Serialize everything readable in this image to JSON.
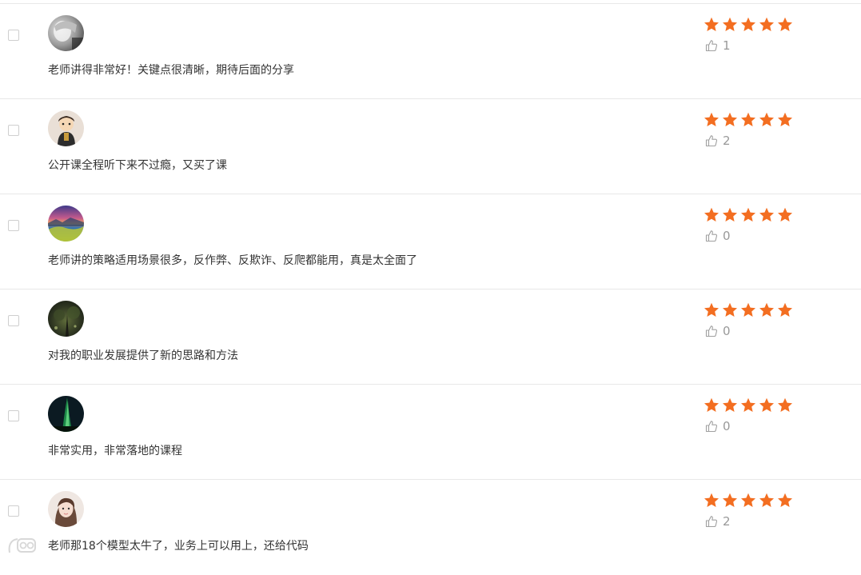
{
  "colors": {
    "star": "#f36e21",
    "divider": "#e8e8e8",
    "like_text": "#999999",
    "text": "#333333"
  },
  "rating_max": 5,
  "reviews": [
    {
      "avatar": "avatar-gray-portrait",
      "comment": "老师讲得非常好！关键点很清晰，期待后面的分享",
      "rating": 5,
      "likes": "1"
    },
    {
      "avatar": "avatar-cartoon-figure",
      "comment": "公开课全程听下来不过瘾，又买了课",
      "rating": 5,
      "likes": "2"
    },
    {
      "avatar": "avatar-sunset-landscape",
      "comment": "老师讲的策略适用场景很多，反作弊、反欺诈、反爬都能用，真是太全面了",
      "rating": 5,
      "likes": "0"
    },
    {
      "avatar": "avatar-dark-forest",
      "comment": "对我的职业发展提供了新的思路和方法",
      "rating": 5,
      "likes": "0"
    },
    {
      "avatar": "avatar-aurora",
      "comment": "非常实用，非常落地的课程",
      "rating": 5,
      "likes": "0"
    },
    {
      "avatar": "avatar-girl-portrait",
      "comment": "老师那18个模型太牛了，业务上可以用上，还给代码",
      "rating": 5,
      "likes": "2"
    }
  ],
  "watermark": {
    "icon": "camera-logo-icon"
  }
}
